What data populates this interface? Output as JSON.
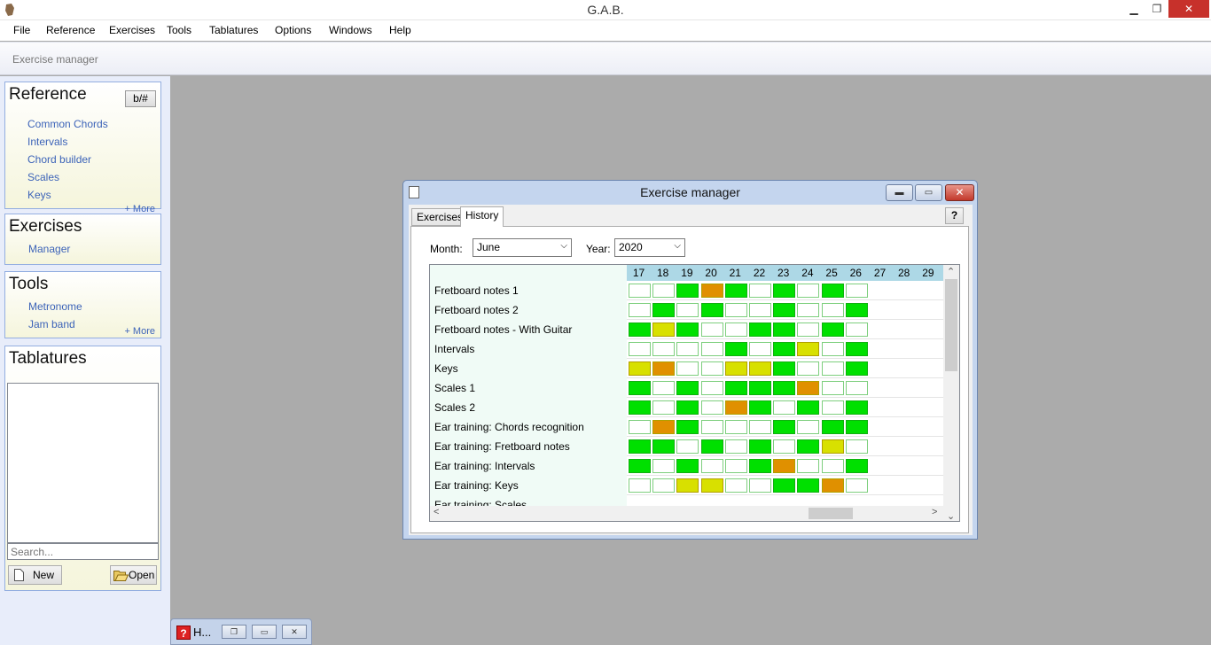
{
  "app": {
    "title": "G.A.B.",
    "controls": {
      "minimize": "▁",
      "restore": "❐",
      "close": "✕"
    }
  },
  "menu": [
    "File",
    "Reference",
    "Exercises",
    "Tools",
    "Tablatures",
    "Options",
    "Windows",
    "Help"
  ],
  "toolstrip": {
    "breadcrumb": "Exercise manager"
  },
  "sidebar": {
    "reference": {
      "title": "Reference",
      "toggle_label": "b/#",
      "links": [
        "Common Chords",
        "Intervals",
        "Chord builder",
        "Scales",
        "Keys"
      ],
      "more": "+ More"
    },
    "exercises": {
      "title": "Exercises",
      "links": [
        "Manager"
      ]
    },
    "tools": {
      "title": "Tools",
      "links": [
        "Metronome",
        "Jam band"
      ],
      "more": "+ More"
    },
    "tablatures": {
      "title": "Tablatures",
      "search_placeholder": "Search...",
      "new_label": "New",
      "open_label": "Open"
    }
  },
  "minimized_window": {
    "label": "H..."
  },
  "exercise_manager": {
    "title": "Exercise manager",
    "tabs": [
      {
        "label": "Exercises",
        "active": false
      },
      {
        "label": "History",
        "active": true
      }
    ],
    "help_label": "?",
    "month_label": "Month:",
    "month_value": "June",
    "year_label": "Year:",
    "year_value": "2020",
    "colors": {
      "green": "#00e000",
      "yellow": "#d8e000",
      "orange": "#e09000",
      "empty": "#ffffff"
    },
    "days": [
      "17",
      "18",
      "19",
      "20",
      "21",
      "22",
      "23",
      "24",
      "25",
      "26",
      "27",
      "28",
      "29"
    ],
    "rows": [
      {
        "name": "Fretboard notes 1",
        "cells": [
          "E",
          "E",
          "G",
          "O",
          "G",
          "E",
          "G",
          "E",
          "G",
          "E"
        ]
      },
      {
        "name": "Fretboard notes 2",
        "cells": [
          "E",
          "G",
          "E",
          "G",
          "E",
          "E",
          "G",
          "E",
          "E",
          "G"
        ]
      },
      {
        "name": "Fretboard notes - With Guitar",
        "cells": [
          "G",
          "Y",
          "G",
          "E",
          "E",
          "G",
          "G",
          "E",
          "G",
          "E"
        ]
      },
      {
        "name": "Intervals",
        "cells": [
          "E",
          "E",
          "E",
          "E",
          "G",
          "E",
          "G",
          "Y",
          "E",
          "G"
        ]
      },
      {
        "name": "Keys",
        "cells": [
          "Y",
          "O",
          "E",
          "E",
          "Y",
          "Y",
          "G",
          "E",
          "E",
          "G"
        ]
      },
      {
        "name": "Scales 1",
        "cells": [
          "G",
          "E",
          "G",
          "E",
          "G",
          "G",
          "G",
          "O",
          "E",
          "E"
        ]
      },
      {
        "name": "Scales 2",
        "cells": [
          "G",
          "E",
          "G",
          "E",
          "O",
          "G",
          "E",
          "G",
          "E",
          "G"
        ]
      },
      {
        "name": "Ear training: Chords recognition",
        "cells": [
          "E",
          "O",
          "G",
          "E",
          "E",
          "E",
          "G",
          "E",
          "G",
          "G"
        ]
      },
      {
        "name": "Ear training: Fretboard notes",
        "cells": [
          "G",
          "G",
          "E",
          "G",
          "E",
          "G",
          "E",
          "G",
          "Y",
          "E"
        ]
      },
      {
        "name": "Ear training: Intervals",
        "cells": [
          "G",
          "E",
          "G",
          "E",
          "E",
          "G",
          "O",
          "E",
          "E",
          "G"
        ]
      },
      {
        "name": "Ear training: Keys",
        "cells": [
          "E",
          "E",
          "Y",
          "Y",
          "E",
          "E",
          "G",
          "G",
          "O",
          "E"
        ]
      },
      {
        "name": "Ear training: Scales",
        "cells": []
      }
    ]
  }
}
